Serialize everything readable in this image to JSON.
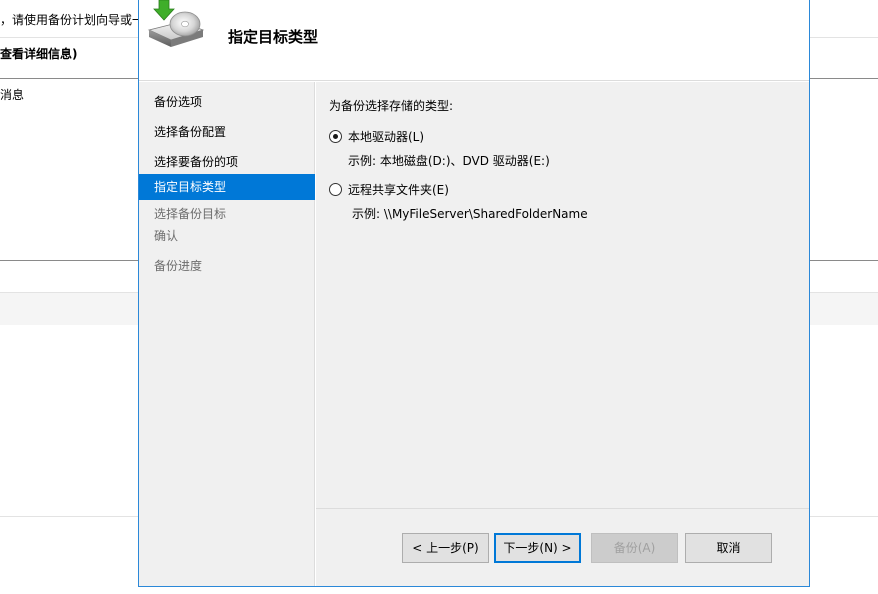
{
  "background_window": {
    "intro_text": "，请使用备份计划向导或一",
    "details_header": "查看详细信息)",
    "messages_label": "消息"
  },
  "wizard": {
    "title": "指定目标类型",
    "steps": [
      {
        "label": "备份选项",
        "state": "done"
      },
      {
        "label": "选择备份配置",
        "state": "done"
      },
      {
        "label": "选择要备份的项",
        "state": "done"
      },
      {
        "label": "指定目标类型",
        "state": "current"
      },
      {
        "label": "选择备份目标",
        "state": "pending"
      },
      {
        "label": "确认",
        "state": "pending"
      },
      {
        "label": "备份进度",
        "state": "pending"
      }
    ],
    "content": {
      "prompt": "为备份选择存储的类型:",
      "options": [
        {
          "label": "本地驱动器(L)",
          "checked": true,
          "example": "示例: 本地磁盘(D:)、DVD 驱动器(E:)"
        },
        {
          "label": "远程共享文件夹(E)",
          "checked": false,
          "example": "示例: \\\\MyFileServer\\SharedFolderName"
        }
      ]
    },
    "buttons": {
      "previous": "< 上一步(P)",
      "next": "下一步(N) >",
      "backup": "备份(A)",
      "cancel": "取消"
    }
  },
  "icons": {
    "header": "backup-drive-with-green-arrow-icon"
  },
  "colors": {
    "selection": "#0078d7",
    "panel": "#f0f0f0",
    "border_accent": "#2b88d8"
  }
}
